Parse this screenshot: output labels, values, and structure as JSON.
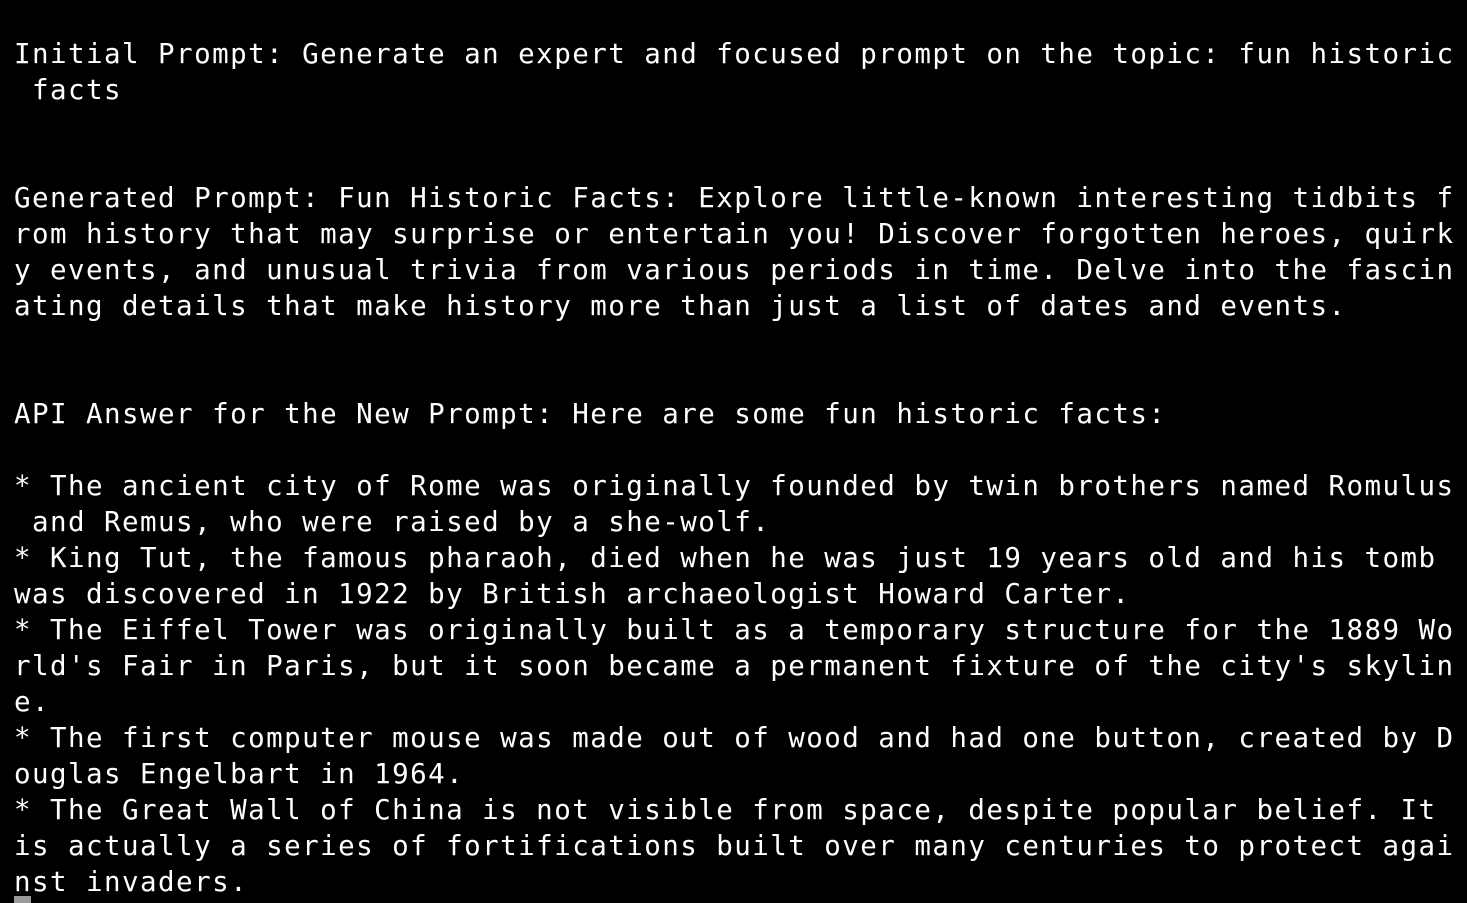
{
  "terminal": {
    "lines": [
      "Initial Prompt: Generate an expert and focused prompt on the topic: fun historic",
      " facts",
      "Generated Prompt: Fun Historic Facts: Explore little-known interesting tidbits f",
      "rom history that may surprise or entertain you! Discover forgotten heroes, quirk",
      "y events, and unusual trivia from various periods in time. Delve into the fascin",
      "ating details that make history more than just a list of dates and events.",
      "API Answer for the New Prompt: Here are some fun historic facts:",
      "* The ancient city of Rome was originally founded by twin brothers named Romulus",
      " and Remus, who were raised by a she-wolf.",
      "* King Tut, the famous pharaoh, died when he was just 19 years old and his tomb",
      "was discovered in 1922 by British archaeologist Howard Carter.",
      "* The Eiffel Tower was originally built as a temporary structure for the 1889 Wo",
      "rld's Fair in Paris, but it soon became a permanent fixture of the city's skylin",
      "e.",
      "* The first computer mouse was made out of wood and had one button, created by D",
      "ouglas Engelbart in 1964.",
      "* The Great Wall of China is not visible from space, despite popular belief. It",
      "is actually a series of fortifications built over many centuries to protect agai",
      "nst invaders."
    ]
  },
  "colors": {
    "background": "#000000",
    "foreground": "#ffffff",
    "cursor": "#9a9a9a"
  }
}
